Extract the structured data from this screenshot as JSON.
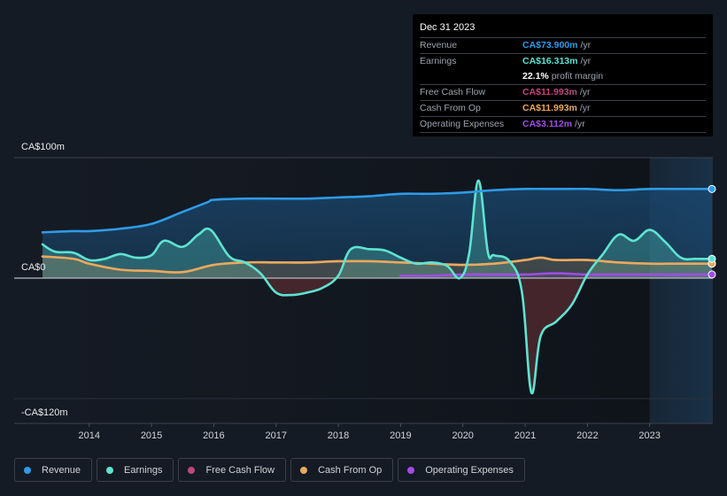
{
  "tooltip": {
    "date": "Dec 31 2023",
    "rows": [
      {
        "label": "Revenue",
        "value": "CA$73.900m",
        "unit": "/yr",
        "color": "#2f9be6"
      },
      {
        "label": "Earnings",
        "value": "CA$16.313m",
        "unit": "/yr",
        "color": "#5fe3d0"
      },
      {
        "label": "Free Cash Flow",
        "value": "CA$11.993m",
        "unit": "/yr",
        "color": "#c2467e"
      },
      {
        "label": "Cash From Op",
        "value": "CA$11.993m",
        "unit": "/yr",
        "color": "#e8aa5b"
      },
      {
        "label": "Operating Expenses",
        "value": "CA$3.112m",
        "unit": "/yr",
        "color": "#9f4de3"
      }
    ],
    "profit_margin_value": "22.1%",
    "profit_margin_label": "profit margin"
  },
  "legend": [
    {
      "label": "Revenue",
      "color": "#2f9be6"
    },
    {
      "label": "Earnings",
      "color": "#5fe3d0"
    },
    {
      "label": "Free Cash Flow",
      "color": "#c2467e"
    },
    {
      "label": "Cash From Op",
      "color": "#e8aa5b"
    },
    {
      "label": "Operating Expenses",
      "color": "#9f4de3"
    }
  ],
  "chart_data": {
    "type": "area",
    "title": "",
    "xlabel": "",
    "ylabel": "",
    "y_tick_labels": [
      "CA$100m",
      "CA$0",
      "-CA$120m"
    ],
    "y_ticks": [
      100,
      0,
      -100
    ],
    "ylim": [
      -120,
      100
    ],
    "xlim": [
      2013.25,
      2024.0
    ],
    "x_tick_labels": [
      "2014",
      "2015",
      "2016",
      "2017",
      "2018",
      "2019",
      "2020",
      "2021",
      "2022",
      "2023"
    ],
    "x_ticks": [
      2014,
      2015,
      2016,
      2017,
      2018,
      2019,
      2020,
      2021,
      2022,
      2023
    ],
    "forecast_shade_start": 2023.0,
    "grid": true,
    "legend_position": "bottom",
    "series": [
      {
        "name": "Revenue",
        "color": "#2f9be6",
        "x": [
          2013.25,
          2013.75,
          2014.0,
          2014.5,
          2015.0,
          2015.5,
          2015.9,
          2016.0,
          2016.5,
          2017.0,
          2017.5,
          2018.0,
          2018.5,
          2019.0,
          2019.5,
          2020.0,
          2020.5,
          2021.0,
          2021.5,
          2022.0,
          2022.5,
          2023.0,
          2023.5,
          2024.0
        ],
        "values": [
          38,
          39,
          39,
          41,
          45,
          55,
          63,
          65,
          66,
          66,
          66,
          67,
          68,
          70,
          70,
          71,
          73,
          74,
          74,
          74,
          73,
          74,
          74,
          74
        ]
      },
      {
        "name": "Earnings",
        "color": "#5fe3d0",
        "x": [
          2013.25,
          2013.45,
          2013.75,
          2014.0,
          2014.25,
          2014.5,
          2014.75,
          2015.0,
          2015.2,
          2015.5,
          2015.75,
          2015.95,
          2016.25,
          2016.5,
          2016.75,
          2017.0,
          2017.25,
          2017.5,
          2017.75,
          2018.0,
          2018.2,
          2018.5,
          2018.75,
          2019.0,
          2019.25,
          2019.5,
          2019.75,
          2019.95,
          2020.1,
          2020.25,
          2020.4,
          2020.5,
          2020.75,
          2020.95,
          2021.1,
          2021.25,
          2021.5,
          2021.75,
          2022.0,
          2022.25,
          2022.5,
          2022.75,
          2023.0,
          2023.25,
          2023.5,
          2023.75,
          2024.0
        ],
        "values": [
          28,
          22,
          21,
          15,
          16,
          20,
          17,
          19,
          31,
          26,
          36,
          40,
          18,
          13,
          4,
          -12,
          -14,
          -12,
          -8,
          2,
          24,
          24,
          23,
          17,
          12,
          13,
          10,
          0,
          20,
          81,
          22,
          19,
          14,
          -12,
          -95,
          -48,
          -36,
          -22,
          3,
          20,
          36,
          31,
          40,
          30,
          17,
          16,
          16
        ]
      },
      {
        "name": "Free Cash Flow",
        "color": "#c2467e",
        "x": [
          2013.25,
          2013.75,
          2014.0,
          2014.5,
          2015.0,
          2015.5,
          2016.0,
          2016.5,
          2017.0,
          2017.5,
          2018.0,
          2018.5,
          2019.0,
          2019.5,
          2020.0,
          2020.5,
          2021.0,
          2021.25,
          2021.5,
          2022.0,
          2022.5,
          2023.0,
          2023.5,
          2024.0
        ],
        "values": [
          18,
          16,
          12,
          7,
          6,
          5,
          11,
          13,
          13,
          13,
          14,
          14,
          13,
          12,
          11,
          12,
          15,
          17,
          15,
          15,
          13,
          12,
          12,
          12
        ]
      },
      {
        "name": "Cash From Op",
        "color": "#e8aa5b",
        "x": [
          2013.25,
          2013.75,
          2014.0,
          2014.5,
          2015.0,
          2015.5,
          2016.0,
          2016.5,
          2017.0,
          2017.5,
          2018.0,
          2018.5,
          2019.0,
          2019.5,
          2020.0,
          2020.5,
          2021.0,
          2021.25,
          2021.5,
          2022.0,
          2022.5,
          2023.0,
          2023.5,
          2024.0
        ],
        "values": [
          18,
          16,
          12,
          7,
          6,
          5,
          11,
          13,
          13,
          13,
          14,
          14,
          13,
          12,
          11,
          12,
          15,
          17,
          15,
          15,
          13,
          12,
          12,
          12
        ]
      },
      {
        "name": "Operating Expenses",
        "color": "#9f4de3",
        "x": [
          2019.0,
          2019.5,
          2020.0,
          2020.5,
          2021.0,
          2021.5,
          2022.0,
          2022.5,
          2023.0,
          2023.5,
          2024.0
        ],
        "values": [
          2,
          2,
          3,
          3,
          3,
          4,
          3,
          3,
          3,
          3,
          3
        ]
      }
    ]
  }
}
